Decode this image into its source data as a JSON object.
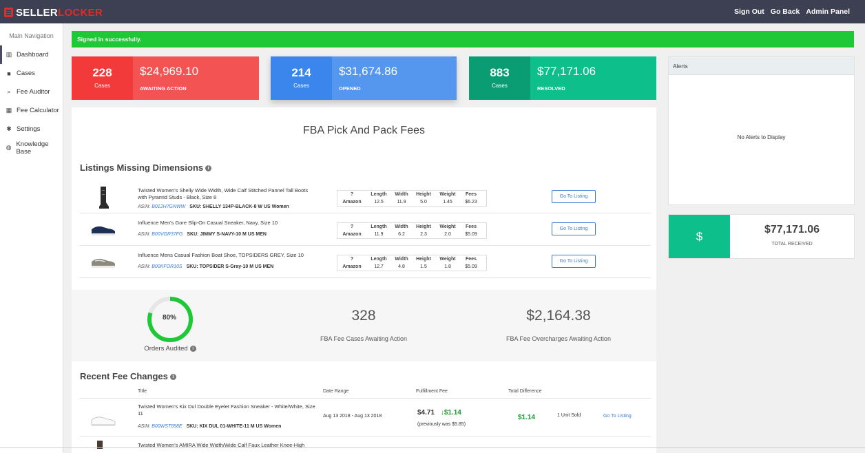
{
  "app": {
    "brand_a": "SELLER",
    "brand_b": "LOCKER"
  },
  "toplinks": [
    "Sign Out",
    "Go Back",
    "Admin Panel"
  ],
  "sidebar": {
    "heading": "Main Navigation",
    "items": [
      {
        "label": "Dashboard",
        "icon": "chart-icon",
        "active": true
      },
      {
        "label": "Cases",
        "icon": "briefcase-icon"
      },
      {
        "label": "Fee Auditor",
        "icon": "search-icon"
      },
      {
        "label": "Fee Calculator",
        "icon": "calculator-icon"
      },
      {
        "label": "Settings",
        "icon": "gear-icon"
      },
      {
        "label": "Knowledge Base",
        "icon": "globe-icon"
      }
    ]
  },
  "flash": "Signed in successfully.",
  "stats": [
    {
      "count": "228",
      "count_label": "Cases",
      "amount": "$24,969.10",
      "status": "AWAITING ACTION",
      "color": "#f23a3a"
    },
    {
      "count": "214",
      "count_label": "Cases",
      "amount": "$31,674.86",
      "status": "OPENED",
      "color": "#3a86ec"
    },
    {
      "count": "883",
      "count_label": "Cases",
      "amount": "$77,171.06",
      "status": "RESOLVED",
      "color": "#0dbf8b"
    }
  ],
  "fba_title": "FBA Pick And Pack Fees",
  "missing_title": "Listings Missing Dimensions",
  "dim_headers": [
    "Length",
    "Width",
    "Height",
    "Weight",
    "Fees"
  ],
  "dim_source": "Amazon",
  "goto_label": "Go To Listing",
  "listings": [
    {
      "title": "Twisted Women's Shelly Wide Width, Wide Calf Stitched Pannel Tall Boots with Pyramid Studs - Black, Size 8",
      "asin_label": "ASIN:",
      "asin": "B012H7GNWW",
      "sku": "SKU: SHELLY 134P-BLACK-8 W US Women",
      "dims": [
        "12.5",
        "11.9",
        "5.0",
        "1.45",
        "$6.23"
      ],
      "thumb": "boot"
    },
    {
      "title": "Influence Men's Gore Slip-On Casual Sneaker, Navy, Size 10",
      "asin_label": "ASIN:",
      "asin": "B00VGR37FG",
      "sku": "SKU: JIMMY S-NAVY-10 M US MEN",
      "dims": [
        "11.9",
        "6.2",
        "2.3",
        "2.0",
        "$5.09"
      ],
      "thumb": "navy"
    },
    {
      "title": "Influence Mens Casual Fashion Boat Shoe, TOPSIDERS GREY, Size 10",
      "asin_label": "ASIN:",
      "asin": "B00KFOR10S",
      "sku": "SKU: TOPSIDER S-Gray-10 M US MEN",
      "dims": [
        "12.7",
        "4.8",
        "1.5",
        "1.8",
        "$5.09"
      ],
      "thumb": "grey"
    }
  ],
  "audit": {
    "percent_label": "80%",
    "percent_value": 0.8,
    "orders_label": "Orders Audited",
    "cases_num": "328",
    "cases_label": "FBA Fee Cases Awaiting Action",
    "over_num": "$2,164.38",
    "over_label": "FBA Fee Overcharges Awaiting Action"
  },
  "recent": {
    "title": "Recent Fee Changes",
    "headers": [
      "Title",
      "Date Range",
      "Fulfillment Fee",
      "Total Difference"
    ],
    "rows": [
      {
        "title": "Twisted Women's Kix Dul Double Eyelet Fashion Sneaker - White/White, Size 11",
        "asin_label": "ASIN:",
        "asin": "B00WST898E",
        "sku": "SKU: KIX DUL 01-WHITE-11 M US Women",
        "date_range": "Aug 13 2018 - Aug 13 2018",
        "fee": "$4.71",
        "delta": "$1.14",
        "prev": "(previously was $5.85)",
        "diff": "$1.14",
        "sold": "1 Unit Sold",
        "link": "Go To Listing"
      },
      {
        "title": "Twisted Women's AMIRA Wide Width/Wide Calf Faux Leather Knee-High"
      }
    ]
  },
  "alerts": {
    "title": "Alerts",
    "empty": "No Alerts to Display"
  },
  "total": {
    "icon": "$",
    "amount": "$77,171.06",
    "label": "TOTAL RECEIVED"
  }
}
